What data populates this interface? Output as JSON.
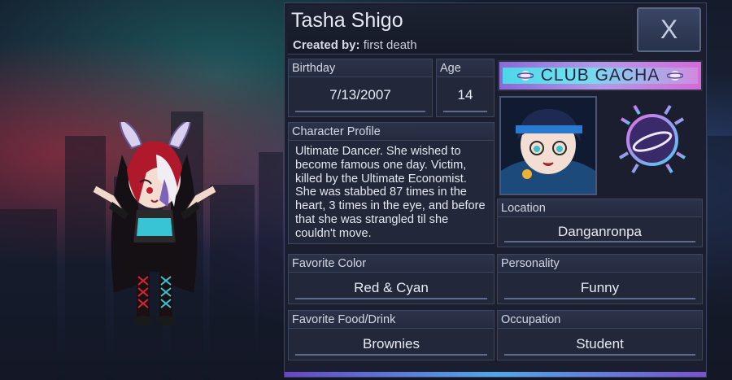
{
  "profile": {
    "name": "Tasha Shigo",
    "created_by_label": "Created by:",
    "created_by_value": "first death",
    "close_label": "X"
  },
  "fields": {
    "birthday": {
      "label": "Birthday",
      "value": "7/13/2007"
    },
    "age": {
      "label": "Age",
      "value": "14"
    },
    "character_profile": {
      "label": "Character Profile",
      "value": "Ultimate Dancer. She wished to become famous one day. Victim, killed by the Ultimate Economist. She was stabbed 87 times in the heart, 3 times in the eye, and before that she was strangled til she couldn't move."
    },
    "location": {
      "label": "Location",
      "value": "Danganronpa"
    },
    "favorite_color": {
      "label": "Favorite Color",
      "value": "Red & Cyan"
    },
    "personality": {
      "label": "Personality",
      "value": "Funny"
    },
    "favorite_food": {
      "label": "Favorite Food/Drink",
      "value": "Brownies"
    },
    "occupation": {
      "label": "Occupation",
      "value": "Student"
    }
  },
  "branding": {
    "banner_text": "CLUB GACHA",
    "logo_icon": "planet-ring-icon"
  },
  "colors": {
    "panel_bg": "#1a1e2e",
    "field_bg": "#222739",
    "accent_cyan": "#4fd6e8",
    "accent_purple": "#8a6ad8",
    "hair_red": "#b0182c",
    "outfit_cyan": "#39c4d6"
  }
}
